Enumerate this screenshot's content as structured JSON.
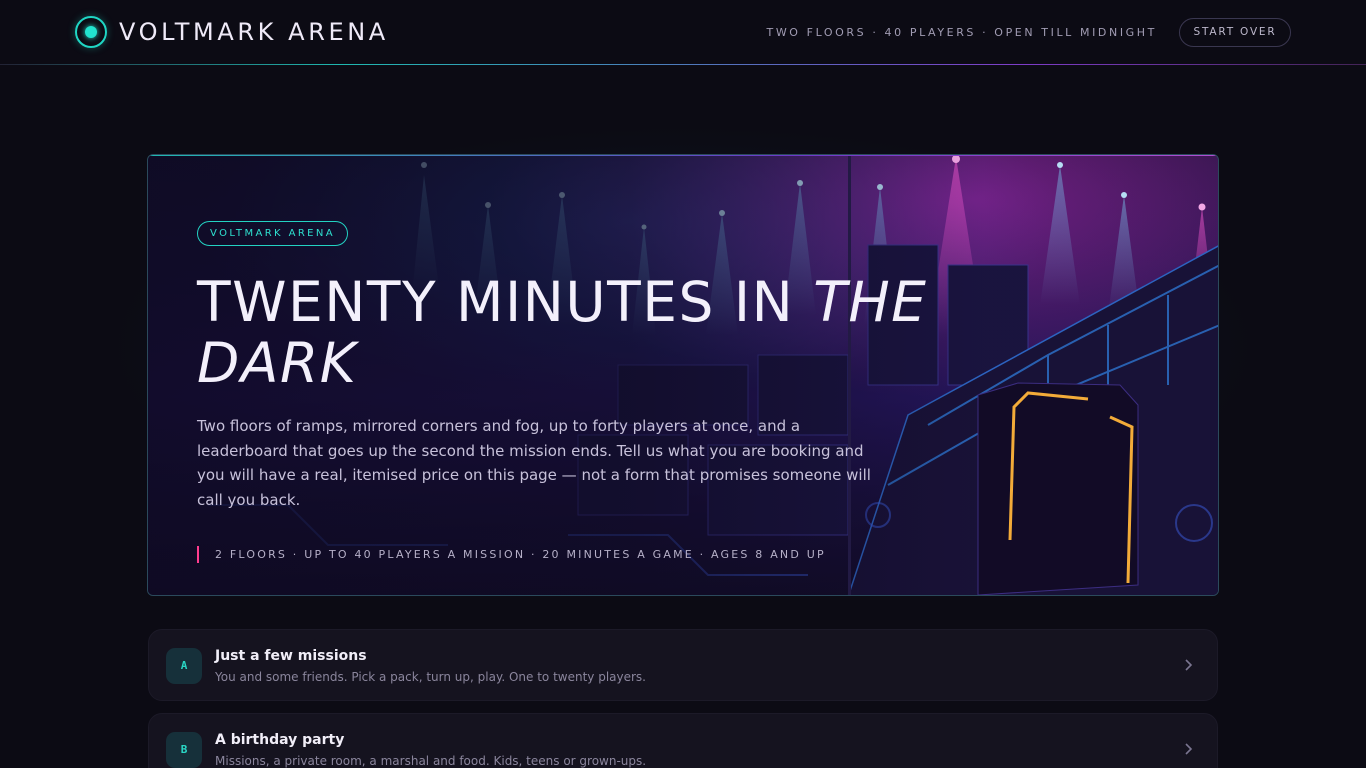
{
  "header": {
    "brand": "VOLTMARK ARENA",
    "meta": "TWO FLOORS · 40 PLAYERS · OPEN TILL MIDNIGHT",
    "start_over": "START OVER",
    "brand_icon": "radar-dot-icon"
  },
  "hero": {
    "badge": "VOLTMARK ARENA",
    "title_main": "TWENTY MINUTES IN ",
    "title_em": "THE DARK",
    "description": "Two floors of ramps, mirrored corners and fog, up to forty players at once, and a leaderboard that goes up the second the mission ends. Tell us what you are booking and you will have a real, itemised price on this page — not a form that promises someone will call you back.",
    "stats": "2 FLOORS · UP TO 40 PLAYERS A MISSION · 20 MINUTES A GAME · AGES 8 AND UP"
  },
  "options": [
    {
      "letter": "A",
      "title": "Just a few missions",
      "subtitle": "You and some friends. Pick a pack, turn up, play. One to twenty players."
    },
    {
      "letter": "B",
      "title": "A birthday party",
      "subtitle": "Missions, a private room, a marshal and food. Kids, teens or grown-ups."
    }
  ],
  "colors": {
    "accent_teal": "#22e3cf",
    "accent_pink": "#ff3c8e",
    "background": "#0c0b14"
  }
}
